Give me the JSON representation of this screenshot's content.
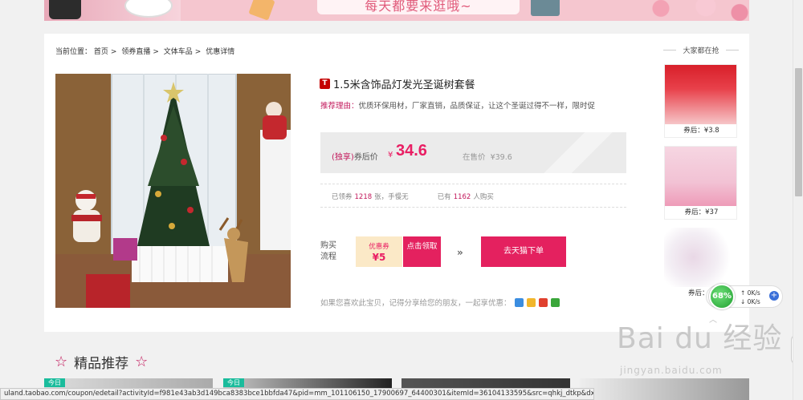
{
  "banner": {
    "text": "每天都要来逛哦~"
  },
  "breadcrumb": {
    "prefix": "当前位置：",
    "items": [
      "首页",
      "领券直播",
      "文体车品",
      "优惠详情"
    ],
    "separator": ">"
  },
  "product": {
    "platform_icon": "T",
    "title": "1.5米含饰品灯发光圣诞树套餐",
    "reason_label": "推荐理由：",
    "reason_text": "优质环保用材，厂家直销，品质保证，让这个圣诞过得不一样，限时促",
    "price_label_excl": "(独享)",
    "price_label": "券后价",
    "currency": "¥",
    "price": "34.6",
    "orig_price_label": "在售价",
    "orig_price": "¥39.6",
    "stats": {
      "coupons_claimed_label": "已领券",
      "coupons_claimed": "1218",
      "coupons_claimed_suffix": "张，手慢无",
      "buyers_label": "已有",
      "buyers": "1162",
      "buyers_suffix": "人购买"
    }
  },
  "flow": {
    "label": "购买流程",
    "coupon_title": "优惠券",
    "coupon_value": "¥5",
    "claim_button": "点击领取",
    "arrows": "»",
    "tmall_button": "去天猫下单"
  },
  "share": {
    "text": "如果您喜欢此宝贝，记得分享给您的朋友，一起享优惠：",
    "icons": [
      "qzone-icon",
      "qq-share-icon",
      "weibo-icon",
      "wechat-icon"
    ]
  },
  "sidebar": {
    "title": "大家都在抢",
    "items": [
      {
        "price": "券后：¥3.8"
      },
      {
        "price": "券后：¥37"
      },
      {
        "price": "券后：¥"
      }
    ]
  },
  "recommend": {
    "title": "精品推荐",
    "cards": [
      {
        "tag": "今日"
      },
      {
        "tag": "今日"
      },
      {
        "tag": ""
      },
      {
        "tag": ""
      }
    ]
  },
  "status_url": "uland.taobao.com/coupon/edetail?activityId=f981e43ab3d149bca8383bce1bbfda47&pid=mm_101106150_17900697_64400301&itemId=36104133595&src=qhkj_dtkp&dx=1",
  "net_widget": {
    "percent": "68%",
    "up": "0K/s",
    "down": "0K/s"
  },
  "watermark": {
    "main": "Bai du 经验",
    "sub": "jingyan.baidu.com"
  },
  "colors": {
    "accent": "#e4215f",
    "price": "#e91e63",
    "coupon_bg": "#fbe9c7"
  }
}
